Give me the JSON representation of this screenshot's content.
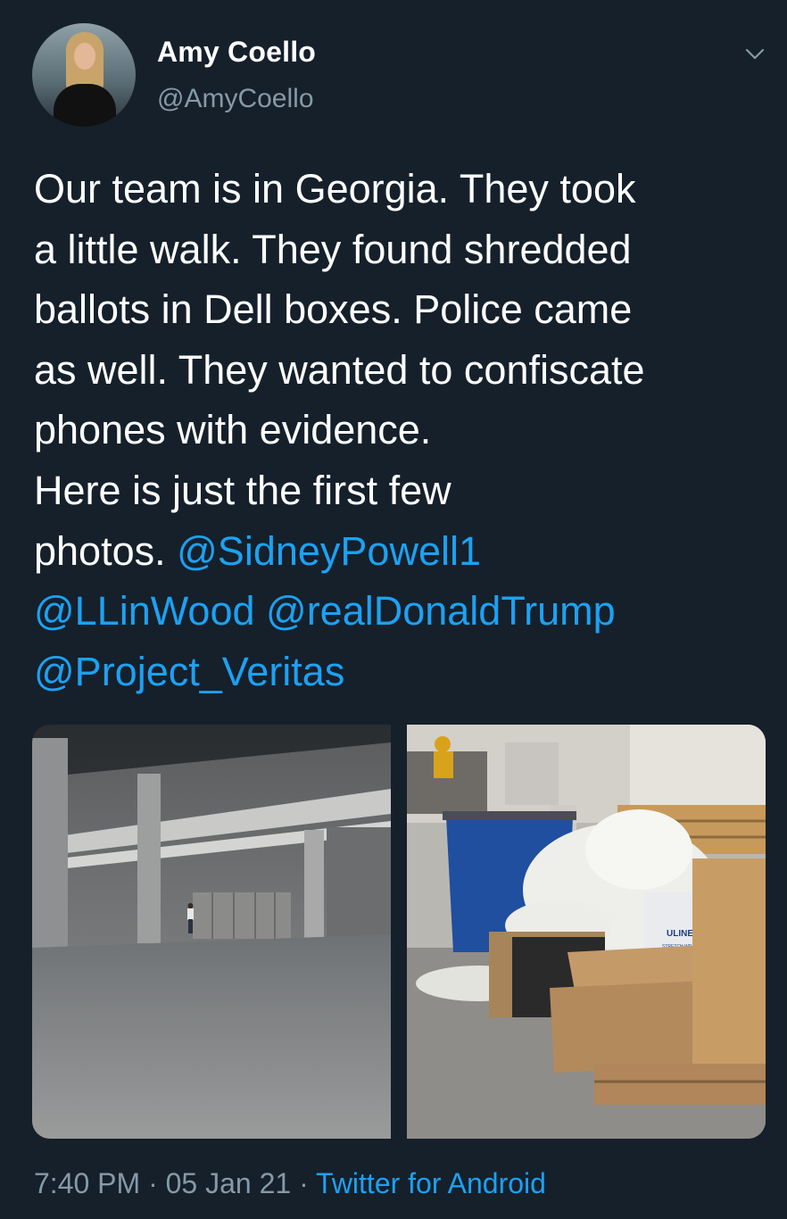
{
  "author": {
    "name": "Amy Coello",
    "handle": "@AmyCoello"
  },
  "tweet": {
    "lines": [
      [
        {
          "text": "Our team is in Georgia. They took"
        }
      ],
      [
        {
          "text": "a little walk. They found shredded"
        }
      ],
      [
        {
          "text": "ballots in Dell boxes. Police came"
        }
      ],
      [
        {
          "text": "as well. They wanted to confiscate"
        }
      ],
      [
        {
          "text": "phones with evidence."
        }
      ],
      [
        {
          "text": "Here is just the first few"
        }
      ],
      [
        {
          "text": "photos. "
        },
        {
          "text": "@SidneyPowell1",
          "mention": true
        }
      ],
      [
        {
          "text": "@LLinWood",
          "mention": true
        },
        {
          "text": " "
        },
        {
          "text": "@realDonaldTrump",
          "mention": true
        }
      ],
      [
        {
          "text": "@Project_Veritas",
          "mention": true
        }
      ]
    ]
  },
  "media": {
    "box_label": "ULINE",
    "box_sublabel": "STRETCH WRAP"
  },
  "meta": {
    "time": "7:40 PM",
    "separator1": " · ",
    "date": "05 Jan 21",
    "separator2": " · ",
    "source": "Twitter for Android"
  },
  "icons": {
    "menu": "chevron-down-icon"
  },
  "colors": {
    "background": "#15202b",
    "text": "#ffffff",
    "secondary": "#8899a6",
    "link": "#1da1f2"
  }
}
